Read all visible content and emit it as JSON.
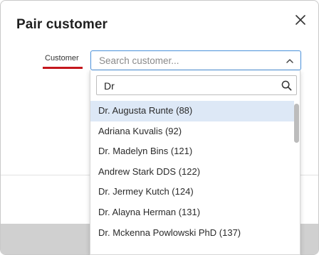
{
  "dialog": {
    "title": "Pair customer",
    "close_icon": "close-icon"
  },
  "form": {
    "customer_label": "Customer",
    "accent_color": "#c4161c",
    "select": {
      "placeholder": "Search customer...",
      "chevron_icon": "chevron-up-icon"
    }
  },
  "dropdown": {
    "filter_value": "Dr",
    "search_icon": "search-icon",
    "options": [
      {
        "label": "Dr. Augusta Runte (88)",
        "selected": true
      },
      {
        "label": "Adriana Kuvalis (92)",
        "selected": false
      },
      {
        "label": "Dr. Madelyn Bins (121)",
        "selected": false
      },
      {
        "label": "Andrew Stark DDS (122)",
        "selected": false
      },
      {
        "label": "Dr. Jermey Kutch (124)",
        "selected": false
      },
      {
        "label": "Dr. Alayna Herman (131)",
        "selected": false
      },
      {
        "label": "Dr. Mckenna Powlowski PhD (137)",
        "selected": false
      }
    ]
  }
}
